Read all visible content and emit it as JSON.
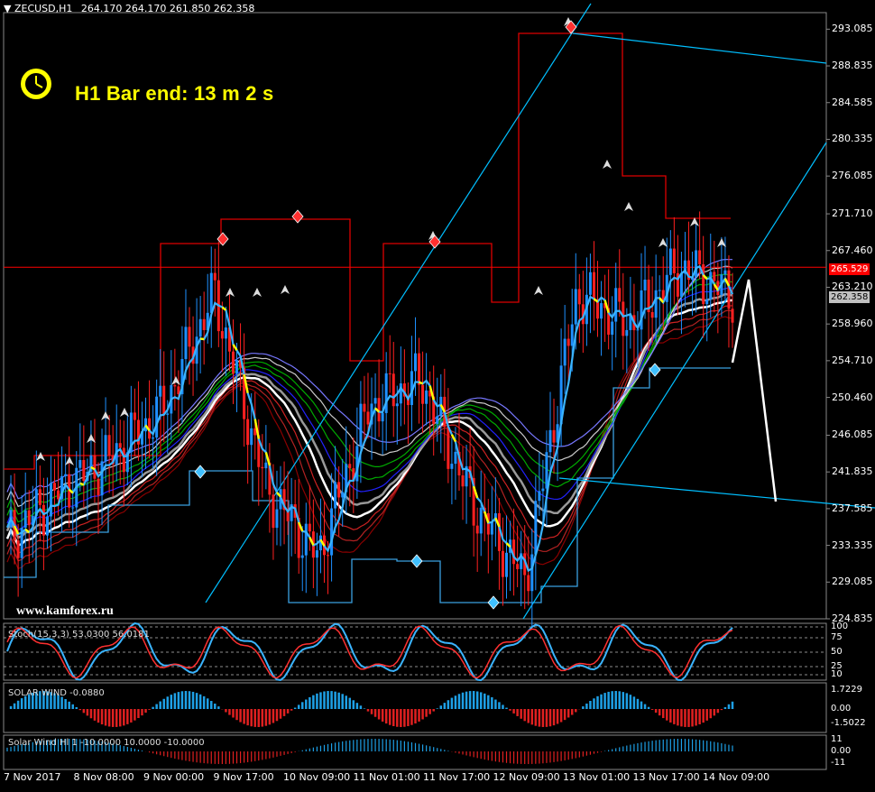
{
  "header": {
    "symbol_tf": "ZECUSD,H1",
    "ohlc": "264.170 264.170 261.850 262.358",
    "menu_arrow": "▼"
  },
  "clock": {
    "label": "H1 Bar end: 13 m 2 s",
    "icon": "alarm-clock-icon",
    "color": "#ffff00"
  },
  "watermark": "www.kamforex.ru",
  "price_axis": {
    "ticks": [
      "293.085",
      "288.835",
      "284.585",
      "280.335",
      "276.085",
      "271.710",
      "267.460",
      "263.210",
      "258.960",
      "254.710",
      "250.460",
      "246.085",
      "241.835",
      "237.585",
      "233.335",
      "229.085",
      "224.835"
    ],
    "current_price": "262.358",
    "marked_price": "265.529",
    "marked_color": "#ff0000"
  },
  "time_axis": {
    "ticks": [
      "7 Nov 2017",
      "8 Nov 08:00",
      "9 Nov 00:00",
      "9 Nov 17:00",
      "10 Nov 09:00",
      "11 Nov 01:00",
      "11 Nov 17:00",
      "12 Nov 09:00",
      "13 Nov 01:00",
      "13 Nov 17:00",
      "14 Nov 09:00"
    ]
  },
  "indicators": {
    "stoch": {
      "title": "Stoch(15,3,3) 53.0300 56.0181",
      "levels": [
        "100",
        "75",
        "50",
        "25",
        "10"
      ]
    },
    "solar_wind": {
      "title": "SOLAR WIND -0.0880",
      "levels": [
        "1.7229",
        "0.00",
        "-1.5022"
      ]
    },
    "third": {
      "title": "Solar Wind Hl 1 -10.0000 10.0000 -10.0000",
      "levels": [
        "11",
        "0.00",
        "-11"
      ]
    }
  },
  "colors": {
    "up_candle": "#1e90ff",
    "down_candle": "#ff2020",
    "channel": "#00bfff",
    "envelope": "#cc0000",
    "signal": "#ffff00"
  },
  "chart_data": {
    "type": "candlestick",
    "symbol": "ZECUSD",
    "timeframe": "H1",
    "ylim": [
      224.835,
      295.0
    ],
    "x": [
      "7 Nov 2017",
      "8 Nov 08:00",
      "9 Nov 00:00",
      "9 Nov 17:00",
      "10 Nov 09:00",
      "11 Nov 01:00",
      "11 Nov 17:00",
      "12 Nov 09:00",
      "13 Nov 01:00",
      "13 Nov 17:00",
      "14 Nov 09:00"
    ],
    "close_path": [
      234.0,
      239.5,
      243.5,
      249.0,
      262.5,
      240.0,
      232.0,
      249.5,
      252.5,
      238.0,
      229.5,
      262.5,
      259.0,
      265.5,
      262.358
    ],
    "last_close": 262.358,
    "resistance": 265.529
  }
}
